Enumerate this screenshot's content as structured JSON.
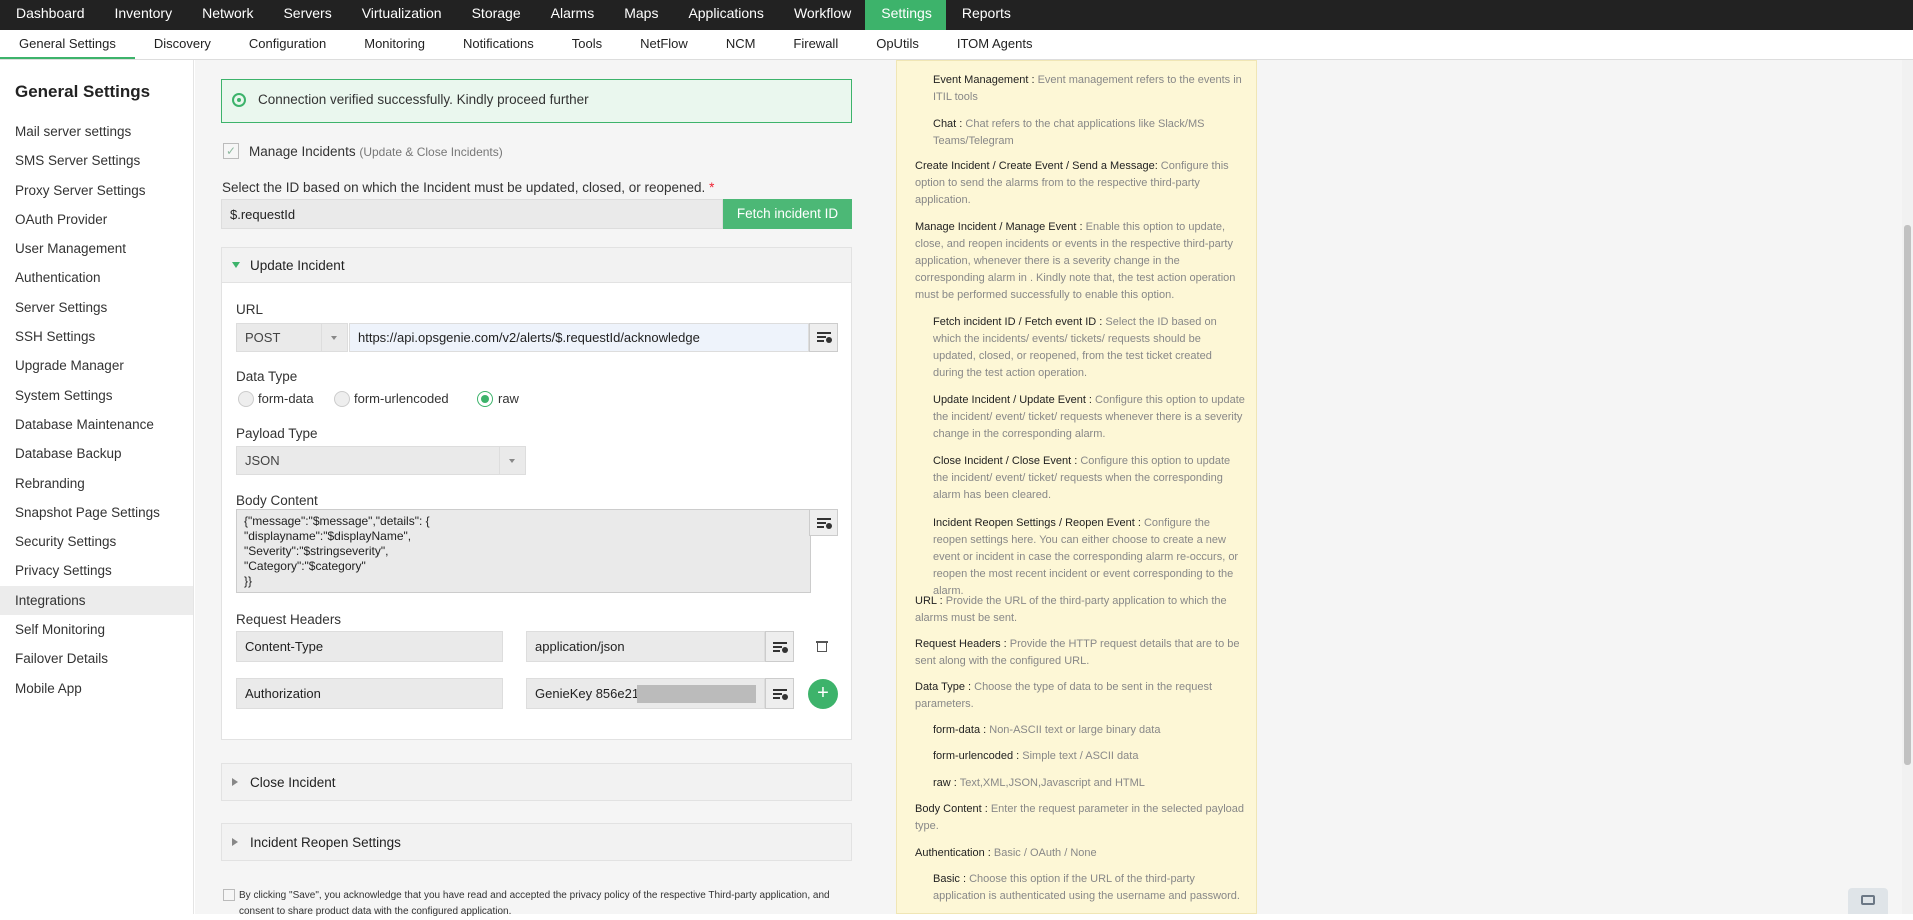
{
  "topnav": [
    "Dashboard",
    "Inventory",
    "Network",
    "Servers",
    "Virtualization",
    "Storage",
    "Alarms",
    "Maps",
    "Applications",
    "Workflow",
    "Settings",
    "Reports"
  ],
  "subnav": [
    "General Settings",
    "Discovery",
    "Configuration",
    "Monitoring",
    "Notifications",
    "Tools",
    "NetFlow",
    "NCM",
    "Firewall",
    "OpUtils",
    "ITOM Agents"
  ],
  "sidebar": {
    "title": "General Settings",
    "items": [
      "Mail server settings",
      "SMS Server Settings",
      "Proxy Server Settings",
      "OAuth Provider",
      "User Management",
      "Authentication",
      "Server Settings",
      "SSH Settings",
      "Upgrade Manager",
      "System Settings",
      "Database Maintenance",
      "Database Backup",
      "Rebranding",
      "Snapshot Page Settings",
      "Security Settings",
      "Privacy Settings",
      "Integrations",
      "Self Monitoring",
      "Failover Details",
      "Mobile App"
    ]
  },
  "alert": {
    "text": "Connection verified successfully. Kindly proceed further"
  },
  "manage": {
    "label": "Manage Incidents",
    "sub": "(Update & Close Incidents)"
  },
  "id_select": {
    "label": "Select the ID based on which the Incident must be updated, closed, or reopened.",
    "required": "*",
    "value": "$.requestId",
    "button": "Fetch incident ID"
  },
  "update": {
    "title": "Update Incident",
    "url_label": "URL",
    "method": "POST",
    "url": "https://api.opsgenie.com/v2/alerts/$.requestId/acknowledge",
    "data_type_label": "Data Type",
    "data_types": [
      "form-data",
      "form-urlencoded",
      "raw"
    ],
    "payload_label": "Payload Type",
    "payload": "JSON",
    "body_label": "Body Content",
    "body": "{\"message\":\"$message\",\"details\": {\n\"displayname\":\"$displayName\",\n\"Severity\":\"$stringseverity\",\n\"Category\":\"$category\"\n}}",
    "headers_label": "Request Headers",
    "headers": [
      {
        "key": "Content-Type",
        "value": "application/json"
      },
      {
        "key": "Authorization",
        "value": "GenieKey 856e21"
      }
    ],
    "add": "+"
  },
  "close": {
    "title": "Close Incident"
  },
  "reopen": {
    "title": "Incident Reopen Settings"
  },
  "consent": "By clicking \"Save\", you acknowledge that you have read and accepted the privacy policy of the respective Third-party application, and consent to share product data with the configured application.",
  "help": [
    {
      "b": "Event Management :",
      "t": " Event management refers to the events in ITIL tools"
    },
    {
      "b": "Chat :",
      "t": " Chat refers to the chat applications like Slack/MS Teams/Telegram"
    },
    {
      "b": "Create Incident / Create Event / Send a Message:",
      "t": " Configure this option to send the alarms from  to the respective third-party application."
    },
    {
      "b": "Manage Incident / Manage Event :",
      "t": " Enable this option to update, close, and reopen incidents or events in the respective third-party application, whenever there is a severity change in the corresponding alarm in . Kindly note that, the test action operation must be performed successfully to enable this option."
    },
    {
      "b": "Fetch incident ID / Fetch event ID :",
      "t": " Select the ID based on which the incidents/ events/ tickets/ requests should be updated, closed, or reopened, from the test ticket created during the test action operation."
    },
    {
      "b": "Update Incident / Update Event :",
      "t": " Configure this option to update the incident/ event/ ticket/ requests whenever there is a severity change in the corresponding alarm."
    },
    {
      "b": "Close Incident / Close Event :",
      "t": " Configure this option to update the incident/ event/ ticket/ requests when the corresponding alarm has been cleared."
    },
    {
      "b": "Incident Reopen Settings / Reopen Event :",
      "t": " Configure the reopen settings here. You can either choose to create a new event or incident in case the corresponding alarm re-occurs, or reopen the most recent incident or event corresponding to the alarm."
    },
    {
      "b": "URL :",
      "t": "  Provide the URL of the third-party application to which the alarms must be sent."
    },
    {
      "b": "Request Headers :",
      "t": "  Provide the HTTP request details that are to be sent along with the configured URL."
    },
    {
      "b": "Data Type :",
      "t": " Choose the type of data to be sent in the request parameters."
    },
    {
      "b": "form-data :",
      "t": " Non-ASCII text or large binary data"
    },
    {
      "b": "form-urlencoded :",
      "t": " Simple text / ASCII data"
    },
    {
      "b": "raw :",
      "t": " Text,XML,JSON,Javascript and HTML"
    },
    {
      "b": "Body Content :",
      "t": " Enter the request parameter in the selected payload type."
    },
    {
      "b": "Authentication :",
      "t": " Basic / OAuth / None"
    },
    {
      "b": "Basic :",
      "t": " Choose this option if the URL of the third-party application is authenticated using the username and password."
    }
  ]
}
